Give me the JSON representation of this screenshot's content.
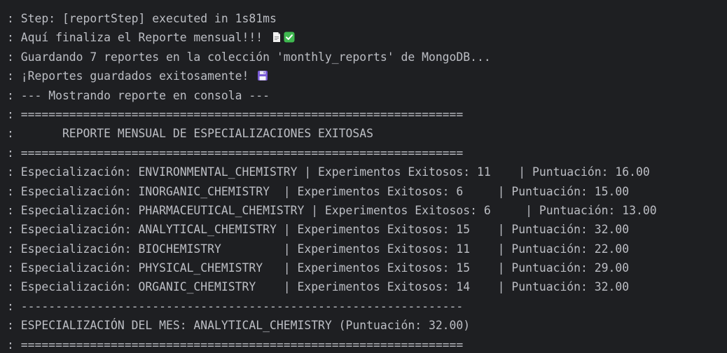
{
  "console": {
    "lines": [
      {
        "text": ": Step: [reportStep] executed in 1s81ms"
      },
      {
        "text": ": Aquí finaliza el Reporte mensual!!! ",
        "icons": [
          "page-icon",
          "check-mark-icon"
        ]
      },
      {
        "text": ": Guardando 7 reportes en la colección 'monthly_reports' de MongoDB..."
      },
      {
        "text": ": ¡Reportes guardados exitosamente! ",
        "icons": [
          "floppy-disk-icon"
        ]
      },
      {
        "text": ": --- Mostrando reporte en consola ---"
      },
      {
        "text": ": ================================================================"
      },
      {
        "text": ":       REPORTE MENSUAL DE ESPECIALIZACIONES EXITOSAS"
      },
      {
        "text": ": ================================================================"
      },
      {
        "text": ": Especialización: ENVIRONMENTAL_CHEMISTRY | Experimentos Exitosos: 11    | Puntuación: 16.00"
      },
      {
        "text": ": Especialización: INORGANIC_CHEMISTRY  | Experimentos Exitosos: 6     | Puntuación: 15.00"
      },
      {
        "text": ": Especialización: PHARMACEUTICAL_CHEMISTRY | Experimentos Exitosos: 6     | Puntuación: 13.00"
      },
      {
        "text": ": Especialización: ANALYTICAL_CHEMISTRY | Experimentos Exitosos: 15    | Puntuación: 32.00"
      },
      {
        "text": ": Especialización: BIOCHEMISTRY         | Experimentos Exitosos: 11    | Puntuación: 22.00"
      },
      {
        "text": ": Especialización: PHYSICAL_CHEMISTRY   | Experimentos Exitosos: 15    | Puntuación: 29.00"
      },
      {
        "text": ": Especialización: ORGANIC_CHEMISTRY    | Experimentos Exitosos: 14    | Puntuación: 32.00"
      },
      {
        "text": ": ----------------------------------------------------------------"
      },
      {
        "text": ": ESPECIALIZACIÓN DEL MES: ANALYTICAL_CHEMISTRY (Puntuación: 32.00)"
      },
      {
        "text": ": ================================================================"
      }
    ]
  },
  "colors": {
    "background": "#1e1f22",
    "text": "#bcbec4",
    "check_green": "#3fb950",
    "floppy_purple": "#7b5cd6"
  }
}
